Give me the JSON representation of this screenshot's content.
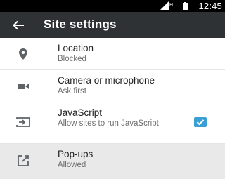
{
  "status_bar": {
    "time": "12:45",
    "icons": [
      "signal-icon",
      "network-type-h-icon",
      "battery-icon"
    ]
  },
  "app_bar": {
    "title": "Site settings",
    "back_icon": "back-arrow-icon"
  },
  "settings": [
    {
      "title": "Location",
      "subtitle": "Blocked",
      "icon": "location-pin-icon"
    },
    {
      "title": "Camera or microphone",
      "subtitle": "Ask first",
      "icon": "videocam-icon"
    },
    {
      "title": "JavaScript",
      "subtitle": "Allow sites to run JavaScript",
      "icon": "javascript-icon",
      "checked": true
    },
    {
      "title": "Pop-ups",
      "subtitle": "Allowed",
      "icon": "popup-open-icon",
      "selected": true
    }
  ],
  "colors": {
    "status_bar": "#000000",
    "app_bar": "#2f3234",
    "checkbox": "#3a9fd4",
    "selected_row": "#e9e9e9"
  }
}
